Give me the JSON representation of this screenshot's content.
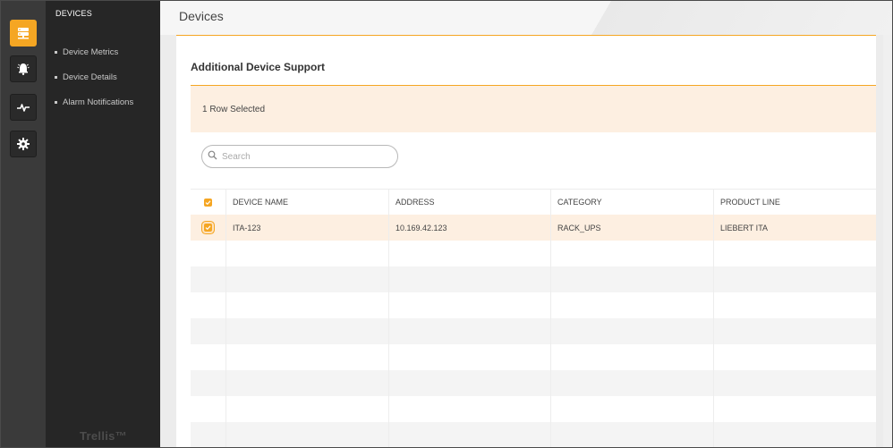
{
  "sidebar": {
    "section_title": "DEVICES",
    "items": [
      {
        "label": "Device Metrics"
      },
      {
        "label": "Device Details"
      },
      {
        "label": "Alarm Notifications"
      }
    ],
    "brand": "Trellis™"
  },
  "rail": {
    "buttons": [
      {
        "icon": "server-icon",
        "active": true
      },
      {
        "icon": "alarm-bell-icon",
        "active": false
      },
      {
        "icon": "pulse-icon",
        "active": false
      },
      {
        "icon": "gear-icon",
        "active": false
      }
    ]
  },
  "page": {
    "title": "Devices",
    "card_title": "Additional Device Support",
    "selection_text": "1 Row Selected"
  },
  "search": {
    "placeholder": "Search",
    "value": ""
  },
  "table": {
    "columns": [
      "DEVICE NAME",
      "ADDRESS",
      "CATEGORY",
      "PRODUCT LINE"
    ],
    "rows": [
      {
        "selected": true,
        "cells": [
          "ITA-123",
          "10.169.42.123",
          "RACK_UPS",
          "LIEBERT ITA"
        ]
      }
    ],
    "header_checkbox_checked": true
  },
  "colors": {
    "accent": "#f5a623",
    "selection_bg": "#fdefe1",
    "rail_bg": "#3a3a3a",
    "sidebar_bg": "#262626"
  }
}
